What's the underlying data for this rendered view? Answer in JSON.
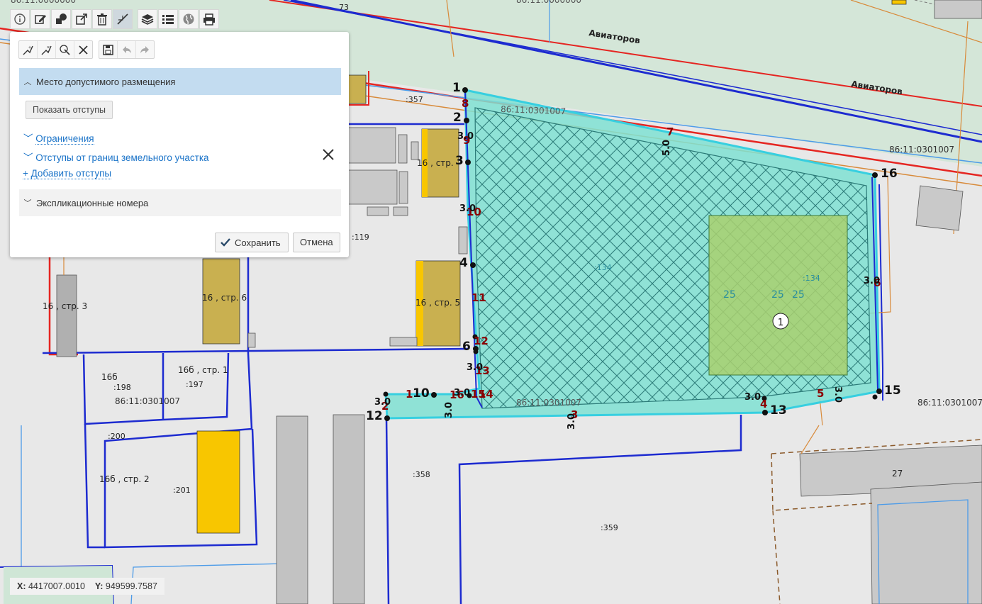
{
  "map": {
    "streets": [
      "Авиаторов",
      "Авиаторов"
    ],
    "top_fragment": "73",
    "top_cadastral": "86:11:0000000",
    "cadastral_block": "86:11:0301007",
    "parcel_labels": [
      ":357",
      ":119",
      ":198",
      ":197",
      ":200",
      ":201",
      ":358",
      ":359",
      ":134",
      ":134"
    ],
    "building_labels": [
      "16 , стр. 3",
      "16 , стр. 6",
      "16 , стр. 5",
      "16б",
      "16б , стр. 1",
      "16б , стр. 2",
      "27",
      "16 , стр."
    ],
    "vertex_numbers": [
      "1",
      "2",
      "3",
      "4",
      "6",
      "10",
      "12",
      "13",
      "15",
      "16"
    ],
    "edge_numbers": [
      "8",
      "9",
      "10",
      "11",
      "12",
      "13",
      "14",
      "15",
      "16",
      "1",
      "2",
      "3",
      "4",
      "5",
      "6",
      "7"
    ],
    "offset_labels": [
      "3.0",
      "5.0",
      "3.0",
      "3.0",
      "3.0",
      "3.0",
      "3.0",
      "3.0",
      "3.0",
      "3.0",
      "3.0"
    ],
    "zone_labels": [
      "25",
      "25",
      "25"
    ],
    "marker": "1",
    "colors": {
      "zone_fill": "#7fe0d2",
      "zone_edge": "#37cfe0",
      "building_gold": "#c9b050",
      "building_yellow": "#f8c600",
      "parcel_blue": "#1d2bd0",
      "road_red": "#e52521",
      "inner_green": "#a9d06e"
    }
  },
  "toolbar": {
    "icons": [
      "info-icon",
      "edit-icon",
      "shapes-icon",
      "export-icon",
      "trash-icon",
      "measure-icon",
      "layers-icon",
      "list-icon",
      "globe-icon",
      "print-icon"
    ]
  },
  "panel": {
    "tools": [
      "add-point-icon",
      "delete-point-icon",
      "select-point-icon",
      "close-icon",
      "save-icon",
      "undo-icon",
      "redo-icon"
    ],
    "section_title": "Место допустимого размещения",
    "show_offsets": "Показать отступы",
    "restrictions": "Ограничения",
    "offsets_from_borders": "Отступы от границ земельного участка",
    "add_offsets": "+ Добавить отступы",
    "explication": "Экспликационные номера",
    "save": "Сохранить",
    "cancel": "Отмена"
  },
  "coords": {
    "x_label": "X:",
    "x": "4417007.0010",
    "y_label": "Y:",
    "y": "949599.7587"
  }
}
